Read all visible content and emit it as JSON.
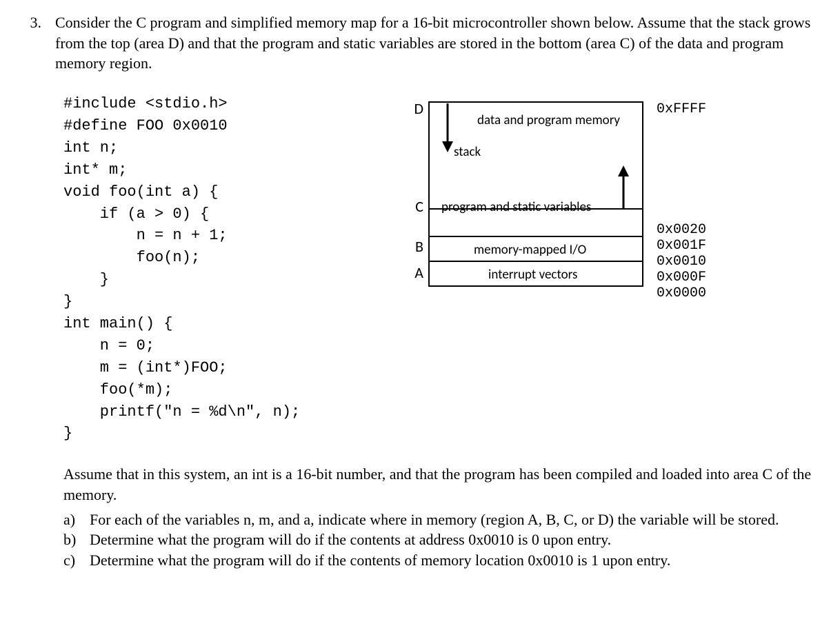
{
  "question_number": "3.",
  "question_intro": "Consider the C program and simplified memory map for a 16-bit microcontroller shown below. Assume that the stack grows from the top (area D) and that the program and static variables are stored in the bottom (area C) of the data and program memory region.",
  "code": "#include <stdio.h>\n#define FOO 0x0010\nint n;\nint* m;\nvoid foo(int a) {\n    if (a > 0) {\n        n = n + 1;\n        foo(n);\n    }\n}\nint main() {\n    n = 0;\n    m = (int*)FOO;\n    foo(*m);\n    printf(\"n = %d\\n\", n);\n}",
  "diagram": {
    "regions": {
      "D": {
        "label": "D",
        "text1": "data and program memory",
        "text2": "stack"
      },
      "C": {
        "label": "C",
        "text": "program and static variables"
      },
      "B": {
        "label": "B",
        "text": "memory-mapped I/O"
      },
      "A": {
        "label": "A",
        "text": "interrupt vectors"
      }
    },
    "addresses": {
      "top": "0xFFFF",
      "c_top": "0x0020",
      "b_top": "0x001F",
      "b_bottom": "0x0010",
      "a_top": "0x000F",
      "a_bottom": "0x0000"
    }
  },
  "assume_text": "Assume that in this system, an int is a 16-bit number, and that the program has been compiled and loaded into area C of the memory.",
  "subparts": {
    "a": {
      "label": "a)",
      "text": "For each of the variables n, m, and a, indicate where in memory (region A, B, C, or D) the variable will be stored."
    },
    "b": {
      "label": "b)",
      "text": "Determine what the program will do if the contents at address 0x0010 is 0 upon entry."
    },
    "c": {
      "label": "c)",
      "text": "Determine what the program will do if the contents of memory location 0x0010 is 1 upon entry."
    }
  }
}
